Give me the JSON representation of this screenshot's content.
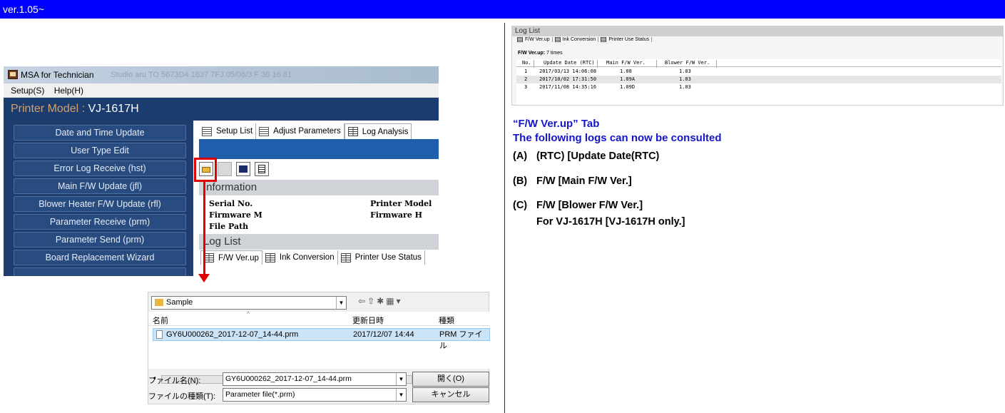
{
  "version_banner": "ver.1.05~",
  "msa": {
    "window_title": "MSA for Technician",
    "title_ghost": "Studio aru  TO 5673D4 1837 7FJ 05/06/3 F 30 16 81",
    "menu": {
      "setup": "Setup(S)",
      "help": "Help(H)"
    },
    "printer_model_label": "Printer Model :",
    "printer_model_value": "VJ-1617H",
    "left_buttons": [
      "Date and Time Update",
      "User Type Edit",
      "Error Log Receive (hst)",
      "Main F/W Update (jfl)",
      "Blower Heater F/W Update (rfl)",
      "Parameter Receive (prm)",
      "Parameter Send (prm)",
      "Board Replacement Wizard"
    ],
    "tabs": [
      "Setup List",
      "Adjust Parameters",
      "Log Analysis"
    ],
    "section_information": "Information",
    "info_labels": {
      "serial": "Serial No.",
      "firmware_m": "Firmware M",
      "file_path": "File Path",
      "printer_model": "Printer Model",
      "firmware_h": "Firmware H"
    },
    "section_log_list": "Log List",
    "log_tabs": [
      "F/W Ver.up",
      "Ink Conversion",
      "Printer Use Status"
    ]
  },
  "dialog": {
    "folder": "Sample",
    "col_name": "名前",
    "col_date": "更新日時",
    "col_type": "種類",
    "file": {
      "name": "GY6U000262_2017-12-07_14-44.prm",
      "date": "2017/12/07 14:44",
      "type": "PRM ファイル"
    },
    "scroll_mark": "III",
    "filename_label": "ファイル名(N):",
    "filename_value": "GY6U000262_2017-12-07_14-44.prm",
    "filetype_label": "ファイルの種類(T):",
    "filetype_value": "Parameter file(*.prm)",
    "open_button": "開く(O)",
    "cancel_button": "キャンセル"
  },
  "log_view": {
    "title": "Log List",
    "tabs": [
      "F/W Ver.up",
      "Ink Conversion",
      "Printer Use Status"
    ],
    "fw_label": "F/W Ver.up:",
    "fw_count": "7 times",
    "headers": [
      "No.",
      "Update Date (RTC)",
      "Main F/W Ver.",
      "Blower F/W Ver."
    ],
    "rows": [
      [
        "1",
        "2017/03/13 14:06:08",
        "1.08",
        "1.03"
      ],
      [
        "2",
        "2017/10/02 17:31:50",
        "1.09A",
        "1.03"
      ],
      [
        "3",
        "2017/11/08 14:35:16",
        "1.09D",
        "1.03"
      ]
    ]
  },
  "notes": {
    "title1": "“F/W Ver.up” Tab",
    "title2": "The following logs can now be consulted",
    "items": [
      {
        "key": "(A)",
        "text": "(RTC) [Update Date(RTC)"
      },
      {
        "key": "(B)",
        "text": "F/W [Main F/W Ver.]"
      },
      {
        "key": "(C)",
        "text": "F/W [Blower F/W Ver.]"
      }
    ],
    "c_sub": "For VJ-1617H [VJ-1617H only.]"
  }
}
